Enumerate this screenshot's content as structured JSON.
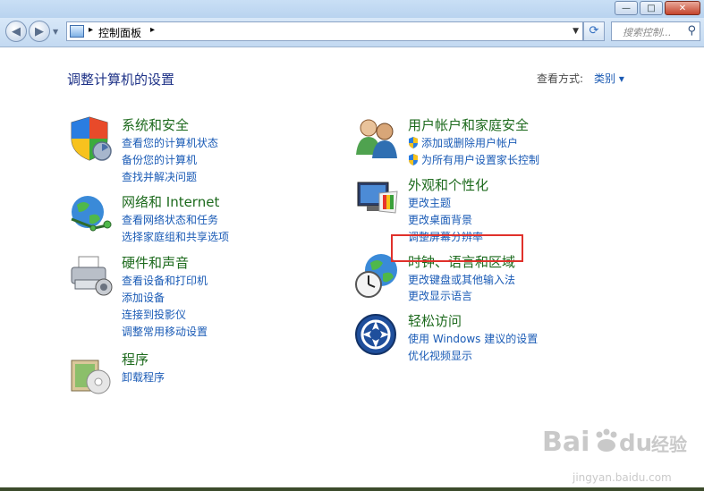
{
  "window": {
    "minimize_glyph": "—",
    "maximize_glyph": "□",
    "close_glyph": "✕"
  },
  "nav": {
    "back_glyph": "◀",
    "forward_glyph": "▶",
    "breadcrumb_separator": "▸",
    "address": "控制面板",
    "search_placeholder": "搜索控制..."
  },
  "page": {
    "title": "调整计算机的设置",
    "view_by_label": "查看方式:",
    "view_by_value": "类别 ▾"
  },
  "categories": {
    "system_security": {
      "title": "系统和安全",
      "links": [
        "查看您的计算机状态",
        "备份您的计算机",
        "查找并解决问题"
      ]
    },
    "network": {
      "title": "网络和 Internet",
      "links": [
        "查看网络状态和任务",
        "选择家庭组和共享选项"
      ]
    },
    "hardware": {
      "title": "硬件和声音",
      "links": [
        "查看设备和打印机",
        "添加设备",
        "连接到投影仪",
        "调整常用移动设置"
      ]
    },
    "programs": {
      "title": "程序",
      "links": [
        "卸载程序"
      ]
    },
    "user_accounts": {
      "title": "用户帐户和家庭安全",
      "links": [
        "添加或删除用户帐户",
        "为所有用户设置家长控制"
      ]
    },
    "appearance": {
      "title": "外观和个性化",
      "links": [
        "更改主题",
        "更改桌面背景",
        "调整屏幕分辨率"
      ]
    },
    "clock_region": {
      "title": "时钟、语言和区域",
      "links": [
        "更改键盘或其他输入法",
        "更改显示语言"
      ]
    },
    "ease_of_access": {
      "title": "轻松访问",
      "links": [
        "使用 Windows 建议的设置",
        "优化视频显示"
      ]
    }
  },
  "watermark": {
    "brand": "Bai",
    "brand_suffix": "du",
    "brand_cn": "经验",
    "url": "jingyan.baidu.com"
  },
  "colors": {
    "title_blue": "#1e3287",
    "category_green": "#1d6a1d",
    "link_blue": "#1a5bb6",
    "highlight_red": "#e0312b"
  },
  "icons": {
    "system_security": "shield-icon",
    "network": "globe-network-icon",
    "hardware": "printer-icon",
    "programs": "programs-box-icon",
    "user_accounts": "users-icon",
    "appearance": "monitor-palette-icon",
    "clock_region": "globe-clock-icon",
    "ease_of_access": "ease-of-access-icon",
    "uac": "uac-shield-icon",
    "search": "search-icon",
    "refresh": "refresh-icon"
  }
}
